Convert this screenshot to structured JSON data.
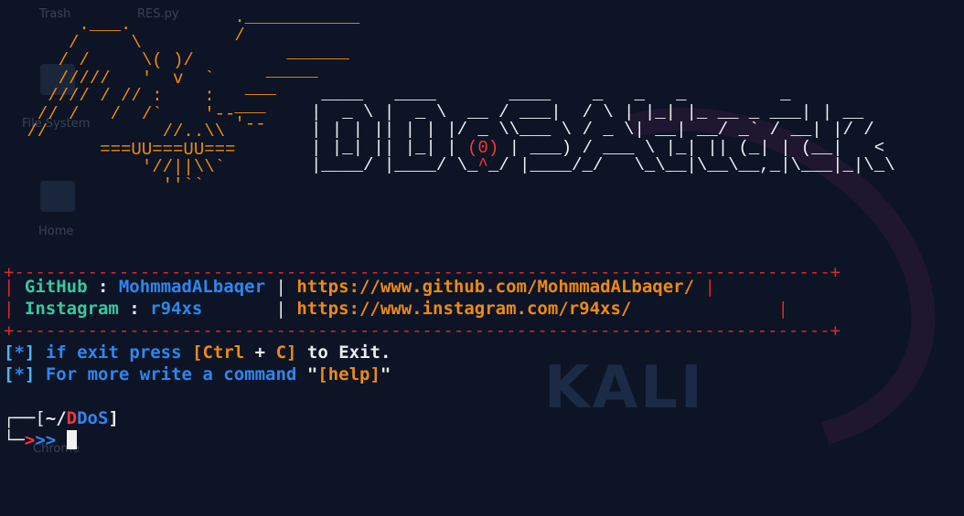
{
  "desktop": {
    "labels": [
      "Trash",
      "RES.py",
      "File System",
      "Home",
      "Chrome"
    ],
    "watermark": "KALI"
  },
  "owl_art": "      .___.      \n     /     \\    \n    / /     \\( )/ \n    /////   '  v  ` \n   //// / // :    : \n  // /   /  /`    '-- \n //           //..\\\\ \n        ===UU===UU===\n            '//||\\\\`\n              ''``",
  "wing_art": " .___________ \n /\n      ______\n    _____\n  ___\n ___\n '--",
  "title_art": {
    "line1": " ____   ____       ____    _   _   _         _    ",
    "line2": "|  _ \\ |  _ \\  __ / ___|  / \\ | |_| |_ __ _ ___| | __",
    "line3": "| | | || | | |/ _ \\\\___ \\ / _ \\| __| __/ _` / __| |/ /",
    "line4": "| |_| || |_| | ",
    "line4_red": "(0)",
    "line4_rest": " | ___) / ___ \\ |_| || (_| | (__|   <",
    "line5": "|____/ |____/ \\_",
    "line5_red": "^",
    "line5_rest": "_/ |____/_/   \\_\\__|\\__\\__,_|\\___|_|\\_\\"
  },
  "banner": {
    "border": "+------------------------------------------------------------------------------+",
    "github_label": "GitHub",
    "github_value": "MohmmadALbaqer",
    "github_url": "https://www.github.com/MohmmadALbaqer/",
    "instagram_label": "Instagram",
    "instagram_value": "r94xs",
    "instagram_url": "https://www.instagram.com/r94xs/"
  },
  "info": {
    "star": "*",
    "line1_text": "if exit press",
    "line1_key1": "Ctrl",
    "line1_plus": "+",
    "line1_key2": "C",
    "line1_end": "to Exit.",
    "line2_text": "For more write a command",
    "line2_cmd": "[help]"
  },
  "prompt": {
    "dir_prefix": "~/",
    "dir_d": "D",
    "dir_dos": "DoS",
    "arrows": ">>>"
  }
}
